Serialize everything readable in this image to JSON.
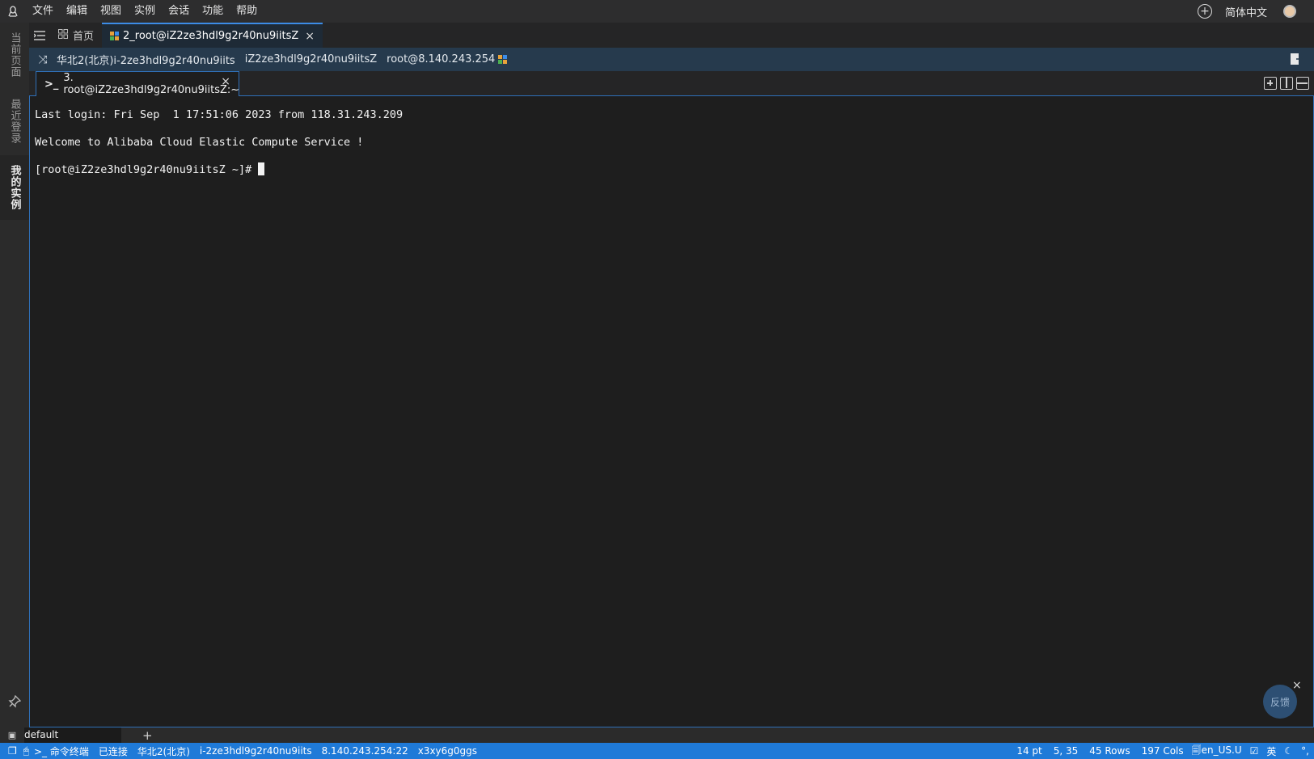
{
  "menubar": {
    "items": [
      "文件",
      "编辑",
      "视图",
      "实例",
      "会话",
      "功能",
      "帮助"
    ],
    "language": "简体中文"
  },
  "sidebar": {
    "tabs": [
      "当前页面",
      "最近登录",
      "我的实例"
    ]
  },
  "tabs": {
    "home_label": "首页",
    "active_label": "2_root@iZ2ze3hdl9g2r40nu9iitsZ"
  },
  "session_info": {
    "region_instance": "华北2(北京)i-2ze3hdl9g2r40nu9iits",
    "hostname": "iZ2ze3hdl9g2r40nu9iitsZ",
    "user_ip": "root@8.140.243.254"
  },
  "terminal_tab": {
    "label": "3. root@iZ2ze3hdl9g2r40nu9iitsZ:~"
  },
  "terminal": {
    "lines": [
      "Last login: Fri Sep  1 17:51:06 2023 from 118.31.243.209",
      "Welcome to Alibaba Cloud Elastic Compute Service !",
      "[root@iZ2ze3hdl9g2r40nu9iitsZ ~]# "
    ]
  },
  "feedback": {
    "label": "反馈"
  },
  "session_bar": {
    "tab": "default"
  },
  "statusbar": {
    "terminal_type": "命令终端",
    "connection": "已连接",
    "region": "华北2(北京)",
    "instance_id": "i-2ze3hdl9g2r40nu9iits",
    "address": "8.140.243.254:22",
    "extra": "x3xy6g0ggs",
    "font_size": "14 pt",
    "cursor_pos": "5, 35",
    "rows": "45 Rows",
    "cols": "197 Cols",
    "locale": "en_US.U",
    "ime": "英"
  },
  "colors": {
    "accent": "#1f7ad8",
    "info_bar": "#263a4d",
    "terminal_bg": "#1e1e1e"
  }
}
